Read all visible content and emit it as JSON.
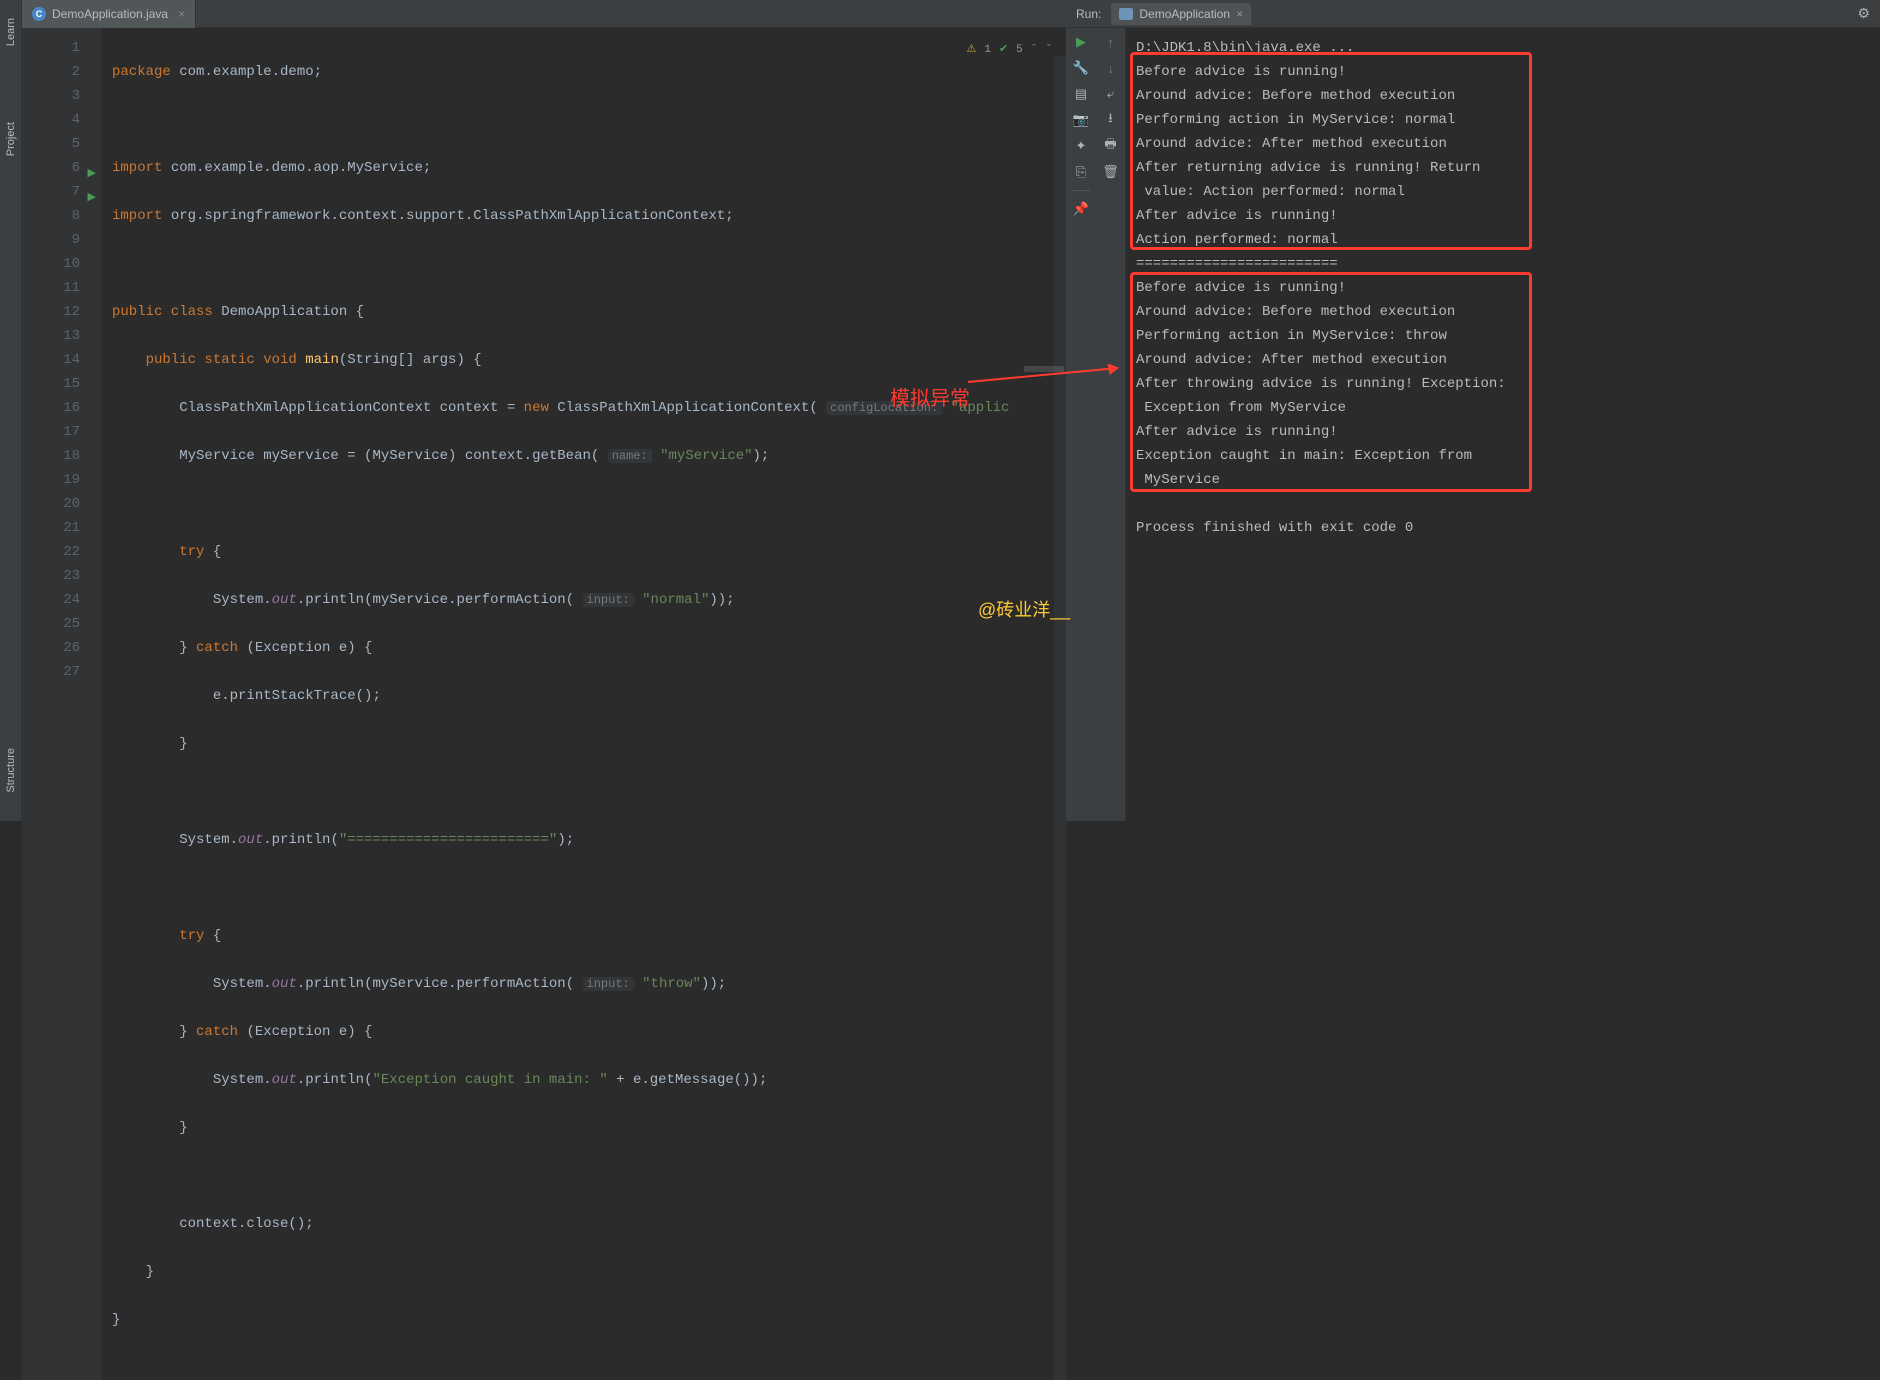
{
  "side_tabs": {
    "learn": "Learn",
    "project": "Project",
    "structure": "Structure"
  },
  "editor": {
    "tab_name": "DemoApplication.java",
    "inspections": {
      "warn_count": "1",
      "ok_count": "5"
    },
    "lines": [
      "1",
      "2",
      "3",
      "4",
      "5",
      "6",
      "7",
      "8",
      "9",
      "10",
      "11",
      "12",
      "13",
      "14",
      "15",
      "16",
      "17",
      "18",
      "19",
      "20",
      "21",
      "22",
      "23",
      "24",
      "25",
      "26",
      "27"
    ],
    "code": {
      "l1_pkg": "package ",
      "l1_rest": "com.example.demo;",
      "l3_imp": "import ",
      "l3_rest": "com.example.demo.aop.MyService;",
      "l4_imp": "import ",
      "l4_rest": "org.springframework.context.support.ClassPathXmlApplicationContext;",
      "l6a": "public class ",
      "l6b": "DemoApplication {",
      "l7a": "    public static void ",
      "l7b": "main",
      "l7c": "(String[] args) {",
      "l8a": "        ClassPathXmlApplicationContext context = ",
      "l8b": "new ",
      "l8c": "ClassPathXmlApplicationContext( ",
      "l8hint": "configLocation:",
      "l8d": " \"applic",
      "l9a": "        MyService myService = (MyService) context.getBean( ",
      "l9hint": "name:",
      "l9b": " ",
      "l9str": "\"myService\"",
      "l9c": ");",
      "l11a": "        try ",
      "l11b": "{",
      "l12a": "            System.",
      "l12fld": "out",
      "l12b": ".println(myService.performAction( ",
      "l12hint": "input:",
      "l12c": " ",
      "l12str": "\"normal\"",
      "l12d": "));",
      "l13a": "        } ",
      "l13b": "catch ",
      "l13c": "(Exception e) {",
      "l14a": "            e.printStackTrace();",
      "l15a": "        }",
      "l17a": "        System.",
      "l17fld": "out",
      "l17b": ".println(",
      "l17str": "\"========================\"",
      "l17c": ");",
      "l19a": "        try ",
      "l19b": "{",
      "l20a": "            System.",
      "l20fld": "out",
      "l20b": ".println(myService.performAction( ",
      "l20hint": "input:",
      "l20c": " ",
      "l20str": "\"throw\"",
      "l20d": "));",
      "l21a": "        } ",
      "l21b": "catch ",
      "l21c": "(Exception e) {",
      "l22a": "            System.",
      "l22fld": "out",
      "l22b": ".println(",
      "l22str": "\"Exception caught in main: \"",
      "l22c": " + e.getMessage());",
      "l23a": "        }",
      "l25a": "        context.close();",
      "l26a": "    }",
      "l27a": "}"
    }
  },
  "annotations": {
    "simulate_exception": "模拟异常",
    "watermark": "@砖业洋__"
  },
  "run": {
    "label": "Run:",
    "config_name": "DemoApplication",
    "output": [
      "D:\\JDK1.8\\bin\\java.exe ...",
      "Before advice is running!",
      "Around advice: Before method execution",
      "Performing action in MyService: normal",
      "Around advice: After method execution",
      "After returning advice is running! Return",
      " value: Action performed: normal",
      "After advice is running!",
      "Action performed: normal",
      "========================",
      "Before advice is running!",
      "Around advice: Before method execution",
      "Performing action in MyService: throw",
      "Around advice: After method execution",
      "After throwing advice is running! Exception:",
      " Exception from MyService",
      "After advice is running!",
      "Exception caught in main: Exception from",
      " MyService",
      "",
      "Process finished with exit code 0"
    ]
  }
}
